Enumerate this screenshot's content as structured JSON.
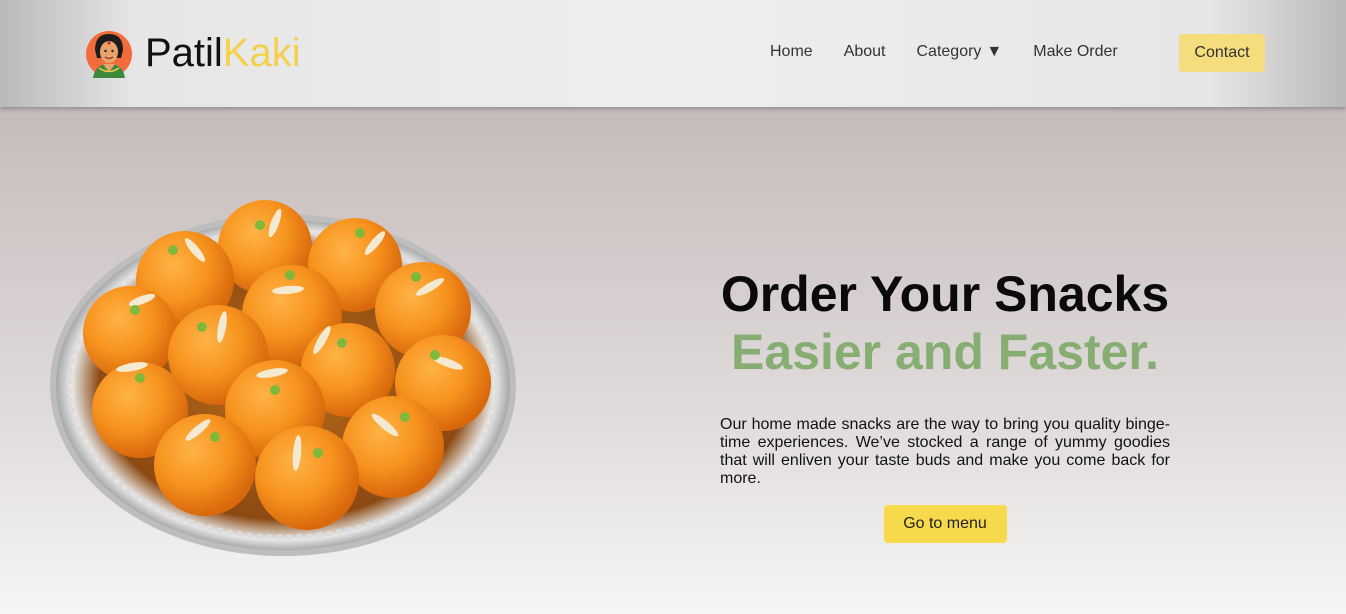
{
  "brand": {
    "name_part1": "Patil",
    "name_part2": "Kaki",
    "accent_color": "#f5d04c",
    "avatar_icon": "woman-avatar-icon"
  },
  "nav": {
    "items": [
      {
        "label": "Home"
      },
      {
        "label": "About"
      },
      {
        "label": "Category",
        "caret": "▼"
      },
      {
        "label": "Make Order"
      }
    ],
    "contact_label": "Contact"
  },
  "hero": {
    "headline_line1": "Order Your Snacks",
    "headline_line2": "Easier and Faster.",
    "headline_accent_color": "#86ad72",
    "description": "Our home made snacks are the way to bring you quality binge-time experiences. We’ve stocked a range of yummy goodies that will enliven your taste buds and make you come back for more.",
    "cta_label": "Go to menu",
    "cta_color": "#f7d94c",
    "image_icon": "laddoo-plate-image"
  }
}
